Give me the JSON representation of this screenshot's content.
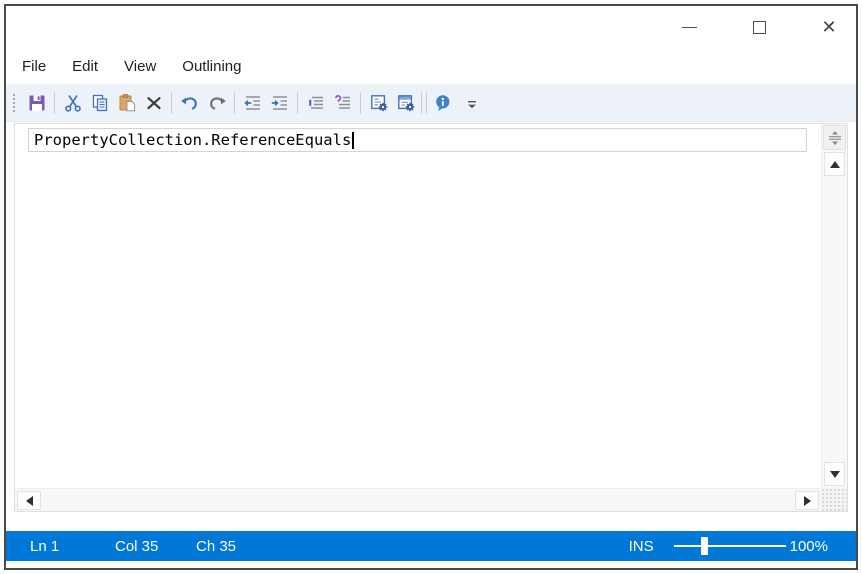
{
  "window": {
    "controls": {
      "minimize": "minimize",
      "maximize": "maximize",
      "close": "close"
    },
    "close_glyph": "✕"
  },
  "menu": {
    "items": [
      "File",
      "Edit",
      "View",
      "Outlining"
    ]
  },
  "toolbar": {
    "icons": [
      "grip",
      "save",
      "cut",
      "copy",
      "paste",
      "delete",
      "undo",
      "redo",
      "decrease-indent",
      "increase-indent",
      "format-selection",
      "format-document",
      "document-options",
      "document-options-alt",
      "info",
      "toolbar-overflow"
    ]
  },
  "editor": {
    "text": "PropertyCollection.ReferenceEquals"
  },
  "status": {
    "line": "Ln 1",
    "column": "Col 35",
    "chars": "Ch 35",
    "insert_mode": "INS",
    "zoom": "100%",
    "zoom_percent": 100,
    "slider_position_percent": 24
  },
  "colors": {
    "statusbar_blue": "#0078d7",
    "toolbar_bg": "#edf2f9",
    "accent_blue": "#3f74bd",
    "save_purple": "#7b57c2",
    "paste_tan": "#dca861",
    "window_border": "#4a4a4a"
  }
}
